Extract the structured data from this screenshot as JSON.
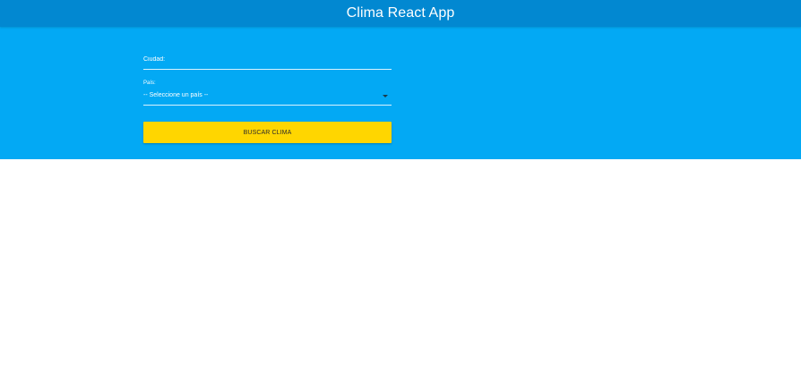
{
  "header": {
    "title": "Clima React App"
  },
  "form": {
    "city": {
      "placeholder": "Ciudad:",
      "value": ""
    },
    "country": {
      "label": "País:",
      "selected": "-- Seleccione un país --"
    },
    "submit_label": "BUSCAR CLIMA"
  },
  "colors": {
    "header_bg": "#0288d1",
    "panel_bg": "#03a9f4",
    "button_bg": "#ffd600"
  },
  "icons": {
    "dropdown": "caret-down-icon"
  }
}
